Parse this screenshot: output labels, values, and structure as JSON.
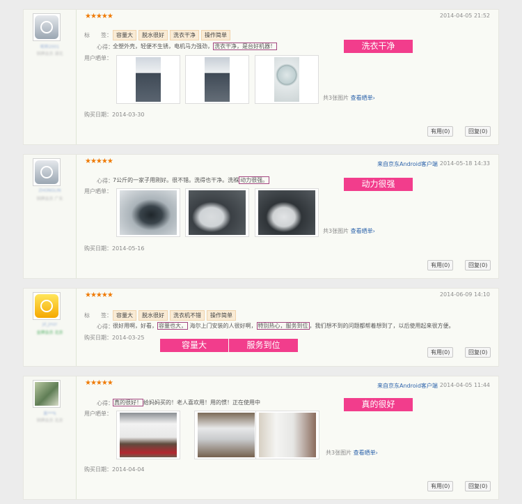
{
  "reviews": [
    {
      "date": "2014-04-05 21:52",
      "stars": "★★★★★",
      "client": "",
      "user_name": "昵称2001",
      "user_level": "铜牌会员 湖北",
      "tag_label": "标　　签：",
      "tags": [
        "容量大",
        "脱水很好",
        "洗衣干净",
        "操作简单"
      ],
      "comment_label": "心得：",
      "comment_before": "全塑外壳，轻便不生锈，电机马力强劲，",
      "comment_highlight": "洗衣干净，是台好机器！",
      "comment_after": "",
      "photos_label": "用户晒单：",
      "photo_count": "共3张图片",
      "view_link": "查看晒单›",
      "purchase": "购买日期：2014-03-30",
      "useful": "有用(0)",
      "reply": "回复(0)",
      "callouts": [
        "洗衣干净"
      ]
    },
    {
      "date": "2014-05-18 14:33",
      "stars": "★★★★★",
      "client": "来自京东Android客户端",
      "user_name": "ZHONGLIN",
      "user_level": "铜牌会员 广东",
      "comment_label": "心得：",
      "comment_before": "7公斤的一家子用刚好。很不错。洗得也干净。洗褓",
      "comment_highlight": "动力很强。",
      "comment_after": "",
      "photos_label": "用户晒单：",
      "photo_count": "共3张图片",
      "view_link": "查看晒单›",
      "purchase": "购买日期：2014-05-16",
      "useful": "有用(0)",
      "reply": "回复(0)",
      "callouts": [
        "动力很强"
      ]
    },
    {
      "date": "2014-06-09 14:10",
      "stars": "★★★★★",
      "client": "",
      "user_name": "jd_jmzr",
      "user_level": "金牌会员 北京",
      "tag_label": "标　　签：",
      "tags": [
        "容量大",
        "脱水很好",
        "洗衣机不错",
        "操作简单"
      ],
      "comment_label": "心得：",
      "comment_before": "很好用啊，好看，",
      "comment_highlight": "容量也大，",
      "comment_mid": "海尔上门安装的人很好啊，",
      "comment_highlight2": "特别热心，服务到位",
      "comment_after": "，我们想不到的问题都帮着想到了，以后使用起来很方便。",
      "purchase": "购买日期：2014-03-25",
      "useful": "有用(0)",
      "reply": "回复(0)",
      "callouts": [
        "容量大",
        "服务到位"
      ]
    },
    {
      "date": "2014-04-05 11:44",
      "stars": "★★★★★",
      "client": "来自京东Android客户端",
      "user_name": "美***k",
      "user_level": "铜牌会员 北京",
      "comment_label": "心得：",
      "comment_before": "",
      "comment_highlight": "真的很好！",
      "comment_after": "给妈妈买的！老人喜欢用！用的惯！正在使用中",
      "photos_label": "用户晒单：",
      "photo_count": "共3张图片",
      "view_link": "查看晒单›",
      "purchase": "购买日期：2014-04-04",
      "useful": "有用(0)",
      "reply": "回复(0)",
      "callouts": [
        "真的很好"
      ]
    }
  ],
  "colors": {
    "callout": "#f23d8c",
    "highlight_border": "#a3457f",
    "link": "#2b62aa",
    "star": "#ef7a06",
    "tag_bg": "#f9ebd5"
  }
}
